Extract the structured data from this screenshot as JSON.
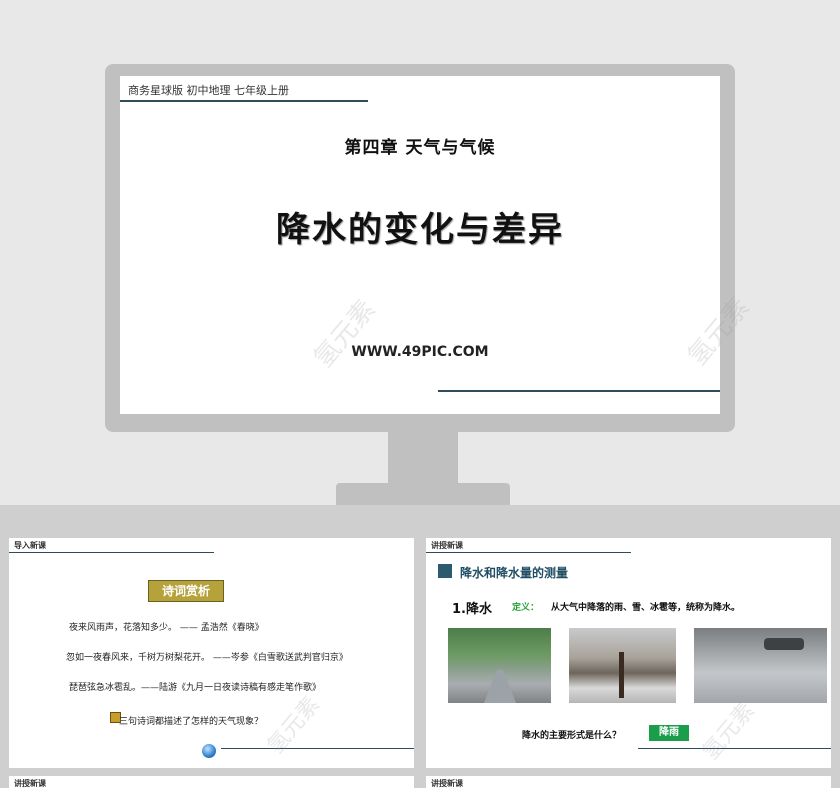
{
  "cover": {
    "header": "商务星球版 初中地理  七年级上册",
    "chapter": "第四章   天气与气候",
    "title": "降水的变化与差异",
    "site": "WWW.49PIC.COM"
  },
  "watermark": "氢元素",
  "slide_intro": {
    "label": "导入新课",
    "badge": "诗词赏析",
    "poems": [
      "夜来风雨声，花落知多少。 —— 孟浩然《春晓》",
      "忽如一夜春风来，千树万树梨花开。 ——岑参《白雪歌送武判官归京》",
      "琵琶弦急冰雹乱。——陆游《九月一日夜读诗稿有感走笔作歌》"
    ],
    "question": "三句诗词都描述了怎样的天气现象？"
  },
  "slide_lesson": {
    "label": "讲授新课",
    "section_title": "降水和降水量的测量",
    "subsection": "1.降水",
    "definition_label": "定义：",
    "definition_text": "从大气中降落的雨、雪、冰雹等，统称为降水。",
    "question": "降水的主要形式是什么？",
    "answer": "降雨"
  },
  "slide_bottom_left": {
    "label": "讲授新课"
  },
  "slide_bottom_right": {
    "label": "讲授新课"
  }
}
